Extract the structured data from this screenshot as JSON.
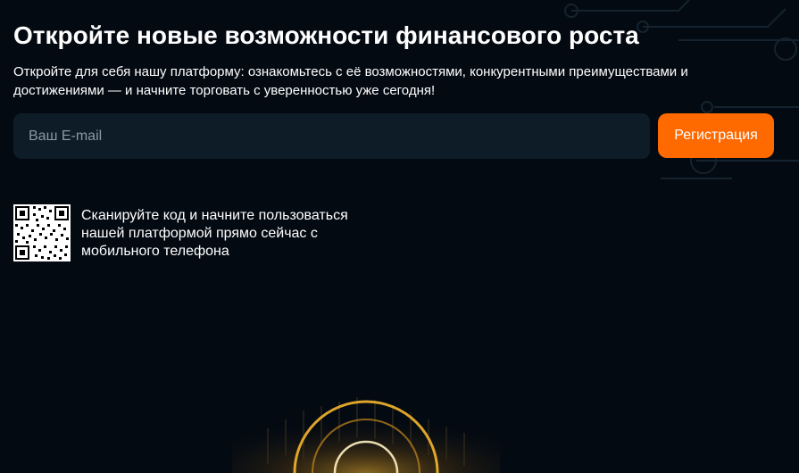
{
  "hero": {
    "title": "Откройте новые возможности финансового роста",
    "subtitle": "Откройте для себя нашу платформу: ознакомьтесь с её возможностями, конкурентными преимуществами и достижениями — и начните торговать с уверенностью уже сегодня!"
  },
  "signup": {
    "email_placeholder": "Ваш E-mail",
    "email_value": "",
    "register_label": "Регистрация"
  },
  "qr": {
    "caption": "Сканируйте код и начните пользоваться нашей платформой прямо сейчас с мобильного телефона"
  },
  "colors": {
    "background": "#040a12",
    "accent": "#ff6a00",
    "input_bg": "#0d1c27",
    "gold_glow": "#f5b62e"
  }
}
